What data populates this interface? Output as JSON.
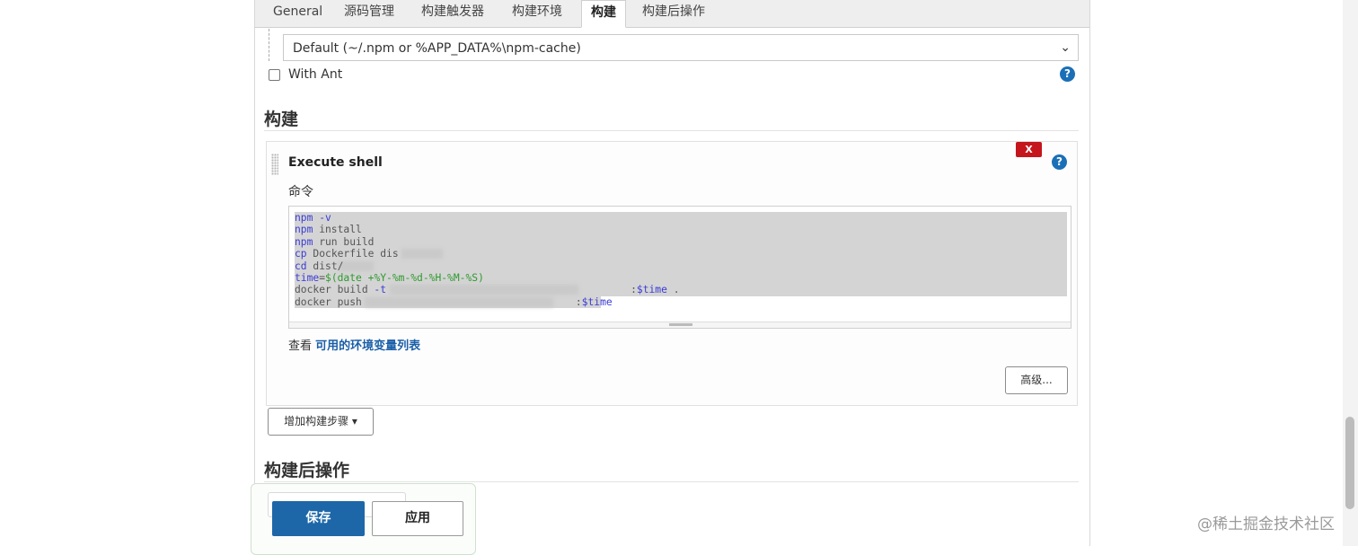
{
  "tabs": [
    {
      "label": "General"
    },
    {
      "label": "源码管理"
    },
    {
      "label": "构建触发器"
    },
    {
      "label": "构建环境"
    },
    {
      "label": "构建",
      "active": true
    },
    {
      "label": "构建后操作"
    }
  ],
  "npm_cache_select": {
    "value": "Default (~/.npm or %APP_DATA%\\npm-cache)",
    "chevron_icon": "chevron-down-icon"
  },
  "with_ant": {
    "label": "With Ant",
    "checked": false
  },
  "help_icon": {
    "glyph": "?"
  },
  "build_section": {
    "title": "构建"
  },
  "execute_shell": {
    "title": "Execute shell",
    "delete_label": "X",
    "command_label": "命令",
    "code_lines": [
      [
        {
          "t": "npm",
          "c": "kw"
        },
        {
          "t": " -v",
          "c": "kw"
        }
      ],
      [
        {
          "t": "npm",
          "c": "kw"
        },
        {
          "t": " install",
          "c": ""
        }
      ],
      [
        {
          "t": "npm",
          "c": "kw"
        },
        {
          "t": " run build",
          "c": ""
        }
      ],
      [
        {
          "t": "cp",
          "c": "kw"
        },
        {
          "t": " Dockerfile dis",
          "c": ""
        }
      ],
      [
        {
          "t": "cd",
          "c": "kw"
        },
        {
          "t": " dist/",
          "c": ""
        }
      ],
      [
        {
          "t": "time",
          "c": "var"
        },
        {
          "t": "=",
          "c": ""
        },
        {
          "t": "$(date +%Y-%m-%d-%H-%M-%S)",
          "c": "str"
        }
      ],
      [
        {
          "t": "docker build ",
          "c": ""
        },
        {
          "t": "-t",
          "c": "kw"
        },
        {
          "t": "                                        ",
          "c": ""
        },
        {
          "t": ":",
          "c": ""
        },
        {
          "t": "$time",
          "c": "var"
        },
        {
          "t": " .",
          "c": ""
        }
      ],
      [
        {
          "t": "docker push ",
          "c": ""
        },
        {
          "t": "                                  ",
          "c": ""
        },
        {
          "t": ":",
          "c": ""
        },
        {
          "t": "$time",
          "c": "var"
        }
      ]
    ],
    "env_prefix": "查看",
    "env_link": "可用的环境变量列表",
    "advanced_button": "高级..."
  },
  "add_step_button": {
    "label": "增加构建步骤",
    "caret": "▾"
  },
  "post_build_section": {
    "title": "构建后操作"
  },
  "save_button": "保存",
  "apply_button": "应用",
  "watermark": "@稀土掘金技术社区"
}
